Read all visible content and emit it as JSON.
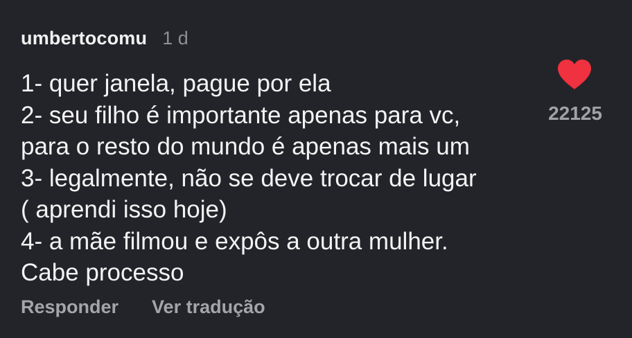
{
  "comment": {
    "username": "umbertocomu",
    "age": "1 d",
    "text_lines": [
      "1- quer janela, pague por ela",
      "2- seu filho é importante apenas para vc,",
      "para o resto do mundo é apenas mais um",
      "3- legalmente, não se deve trocar de lugar",
      "( aprendi isso hoje)",
      "4- a mãe filmou e expôs a outra mulher.",
      "Cabe processo"
    ],
    "like_icon": "heart-icon",
    "like_color": "#f0313f",
    "like_count": "22125",
    "actions": {
      "reply": "Responder",
      "translate": "Ver tradução"
    }
  }
}
